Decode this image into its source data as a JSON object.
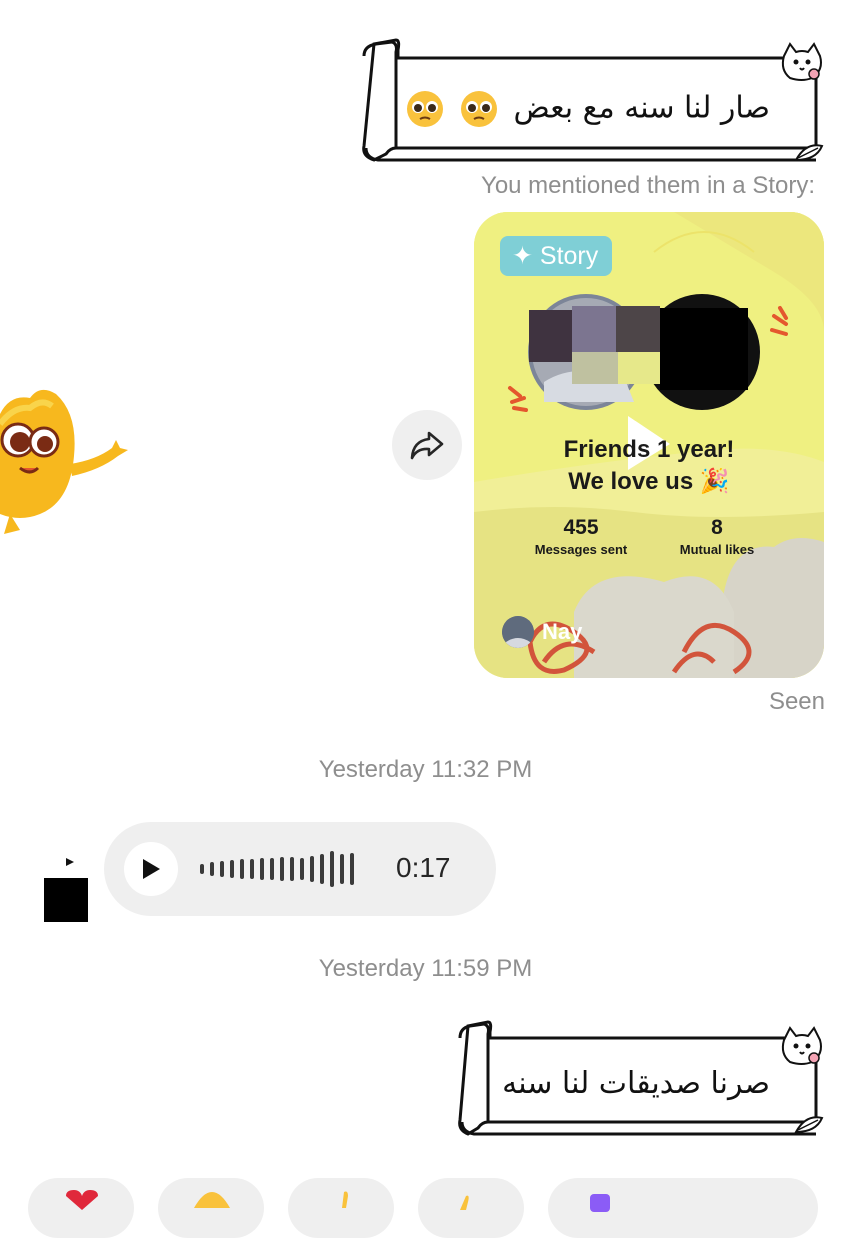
{
  "messages": {
    "sticker_1_text": "صار لنا سنه مع بعض",
    "mention_caption": "You mentioned them in a Story:",
    "story": {
      "badge": "✦ Story",
      "headline_line1": "Friends     1 year!",
      "headline_line2": "We love us 🎉",
      "stats": [
        {
          "value": "455",
          "label": "Messages sent"
        },
        {
          "value": "8",
          "label": "Mutual likes"
        }
      ],
      "author": "Nay"
    },
    "seen_label": "Seen",
    "timestamp_1": "Yesterday 11:32 PM",
    "voice_duration": "0:17",
    "timestamp_2": "Yesterday 11:59 PM",
    "sticker_2_text": "صرنا صديقات لنا سنه"
  },
  "icons": {
    "share": "share-arrow-icon",
    "play": "play-icon",
    "emoji": "pleading-face-emoji"
  },
  "colors": {
    "bubble_gray": "#efefef",
    "meta_gray": "#8e8e8e",
    "story_yellow": "#f0ee8e",
    "badge_teal": "#7fcfd6"
  }
}
